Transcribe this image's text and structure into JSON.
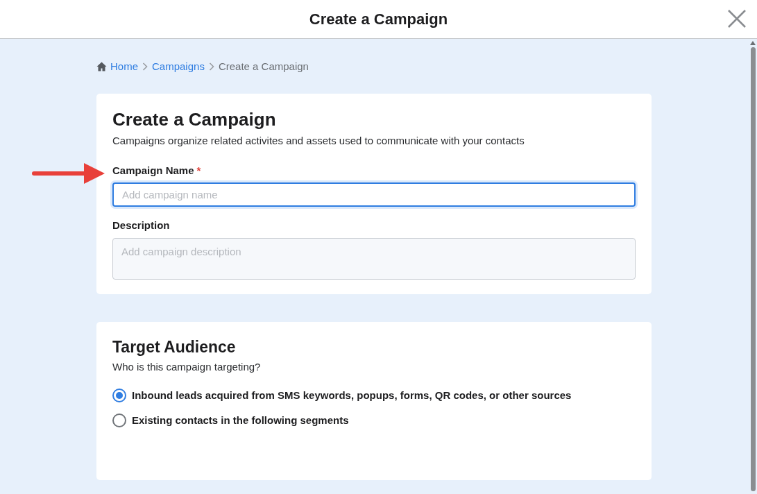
{
  "window": {
    "title": "Create a Campaign"
  },
  "breadcrumb": [
    {
      "label": "Home",
      "kind": "home"
    },
    {
      "label": "Campaigns",
      "kind": "link"
    },
    {
      "label": "Create a Campaign",
      "kind": "current"
    }
  ],
  "details": {
    "title": "Create a Campaign",
    "subtitle": "Campaigns organize related activites and assets used to communicate with your contacts",
    "fields": [
      {
        "label": "Campaign Name",
        "required_mark": "*",
        "placeholder": "Add campaign name",
        "kind": "input",
        "focused": true
      },
      {
        "label": "Description",
        "placeholder": "Add campaign description",
        "kind": "textarea",
        "focused": false
      }
    ]
  },
  "audience": {
    "title": "Target Audience",
    "subtitle": "Who is this campaign targeting?",
    "options": [
      {
        "label": "Inbound leads acquired from SMS keywords, popups, forms, QR codes, or other sources",
        "selected": true
      },
      {
        "label": "Existing contacts in the following segments",
        "selected": false
      }
    ]
  }
}
